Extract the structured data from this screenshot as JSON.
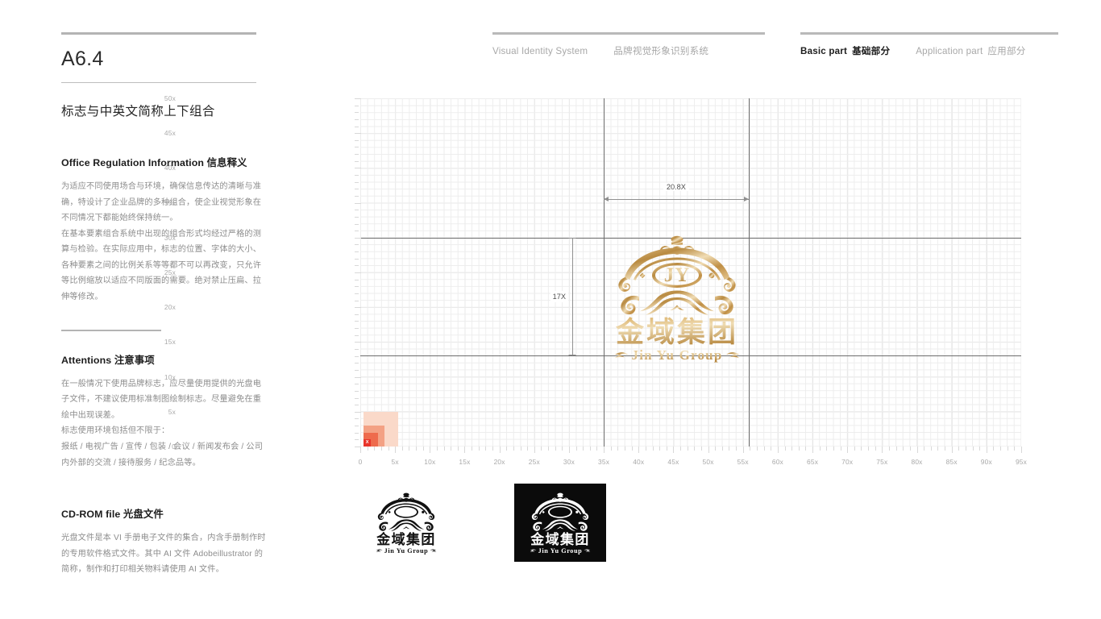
{
  "page": {
    "code": "A6.4",
    "section_title_cn": "标志与中英文简称上下组合"
  },
  "header": {
    "group_vis": [
      {
        "en": "Visual Identity System",
        "cn": ""
      },
      {
        "en": "",
        "cn": "品牌视觉形象识别系统"
      }
    ],
    "group_part": [
      {
        "en": "Basic part",
        "cn": "基础部分",
        "active": true
      },
      {
        "en": "Application part",
        "cn": "应用部分",
        "active": false
      }
    ]
  },
  "blocks": [
    {
      "head_en": "Office Regulation Information",
      "head_cn": "信息释义",
      "paragraphs": [
        "为适应不同使用场合与环境，确保信息传达的清晰与准确，特设计了企业品牌的多种组合，使企业视觉形象在不同情况下都能始终保持统一。",
        "在基本要素组合系统中出现的组合形式均经过严格的测算与检验。在实际应用中，标志的位置、字体的大小、各种要素之间的比例关系等等都不可以再改变，只允许等比例缩放以适应不同版面的需要。绝对禁止压扁、拉伸等修改。"
      ]
    },
    {
      "head_en": "Attentions",
      "head_cn": "注意事项",
      "paragraphs": [
        "在一般情况下使用品牌标志，应尽量使用提供的光盘电子文件，不建议使用标准制图绘制标志。尽量避免在重绘中出现误差。",
        "标志使用环境包括但不限于：",
        "报纸 / 电视广告 / 宣传 / 包装 / 会议 / 新闻发布会 / 公司内外部的交流 / 接待服务 / 纪念品等。"
      ]
    },
    {
      "head_en": "CD-ROM file",
      "head_cn": "光盘文件",
      "paragraphs": [
        "光盘文件是本 VI 手册电子文件的集合，内含手册制作时的专用软件格式文件。其中 AI 文件 Adobeillustrator 的简称，制作和打印相关物料请使用 AI 文件。"
      ]
    }
  ],
  "chart_data": {
    "type": "scatter",
    "title": "",
    "xlabel": "",
    "ylabel": "",
    "xlim": [
      0,
      95
    ],
    "ylim": [
      0,
      50
    ],
    "grid": true,
    "minor_step": 1,
    "major_step": 5,
    "x_ticks": [
      "0",
      "5x",
      "10x",
      "15x",
      "20x",
      "25x",
      "30x",
      "35x",
      "40x",
      "45x",
      "50x",
      "55x",
      "60x",
      "65x",
      "70x",
      "75x",
      "80x",
      "85x",
      "90x",
      "95x"
    ],
    "y_ticks": [
      "0",
      "5x",
      "10x",
      "15x",
      "20x",
      "25x",
      "30x",
      "35x",
      "40x",
      "45x",
      "50x"
    ],
    "reference_lines": {
      "vertical": [
        35,
        55.8
      ],
      "horizontal": [
        13,
        30
      ]
    },
    "annotations": [
      {
        "label": "20.8X",
        "orientation": "horizontal",
        "from": 35,
        "to": 55.8,
        "at_y": 35.5
      },
      {
        "label": "17X",
        "orientation": "vertical",
        "from": 13,
        "to": 30,
        "at_x": 30.5
      }
    ],
    "unit_swatch": {
      "label": "X",
      "steps": [
        {
          "size": 5,
          "color": "#fad9c9"
        },
        {
          "size": 3,
          "color": "#f3a184"
        },
        {
          "size": 2,
          "color": "#ee6b4d"
        },
        {
          "size": 1,
          "color": "#e8342a"
        }
      ],
      "origin": [
        0.5,
        0
      ]
    },
    "logo_bbox": {
      "x": 35,
      "y": 13,
      "width": 20.8,
      "height": 17
    }
  },
  "logo": {
    "monogram": "JY",
    "name_cn": "金域集团",
    "name_en": "Jin Yu Group",
    "gold_light": "#e8cfa0",
    "gold_mid": "#c79a53",
    "gold_dark": "#a87a32",
    "variants": [
      {
        "name": "mono-positive",
        "fg": "#111111",
        "bg": "#ffffff"
      },
      {
        "name": "mono-reversed",
        "fg": "#ffffff",
        "bg": "#0b0b0b"
      }
    ]
  },
  "colors": {
    "rule": "#b4b4b4",
    "body_text": "#8d8d8d",
    "heading": "#1d1d1d",
    "grid_minor": "#ededed",
    "grid_major": "#dcdcdc",
    "reference": "#6e6e6e"
  }
}
